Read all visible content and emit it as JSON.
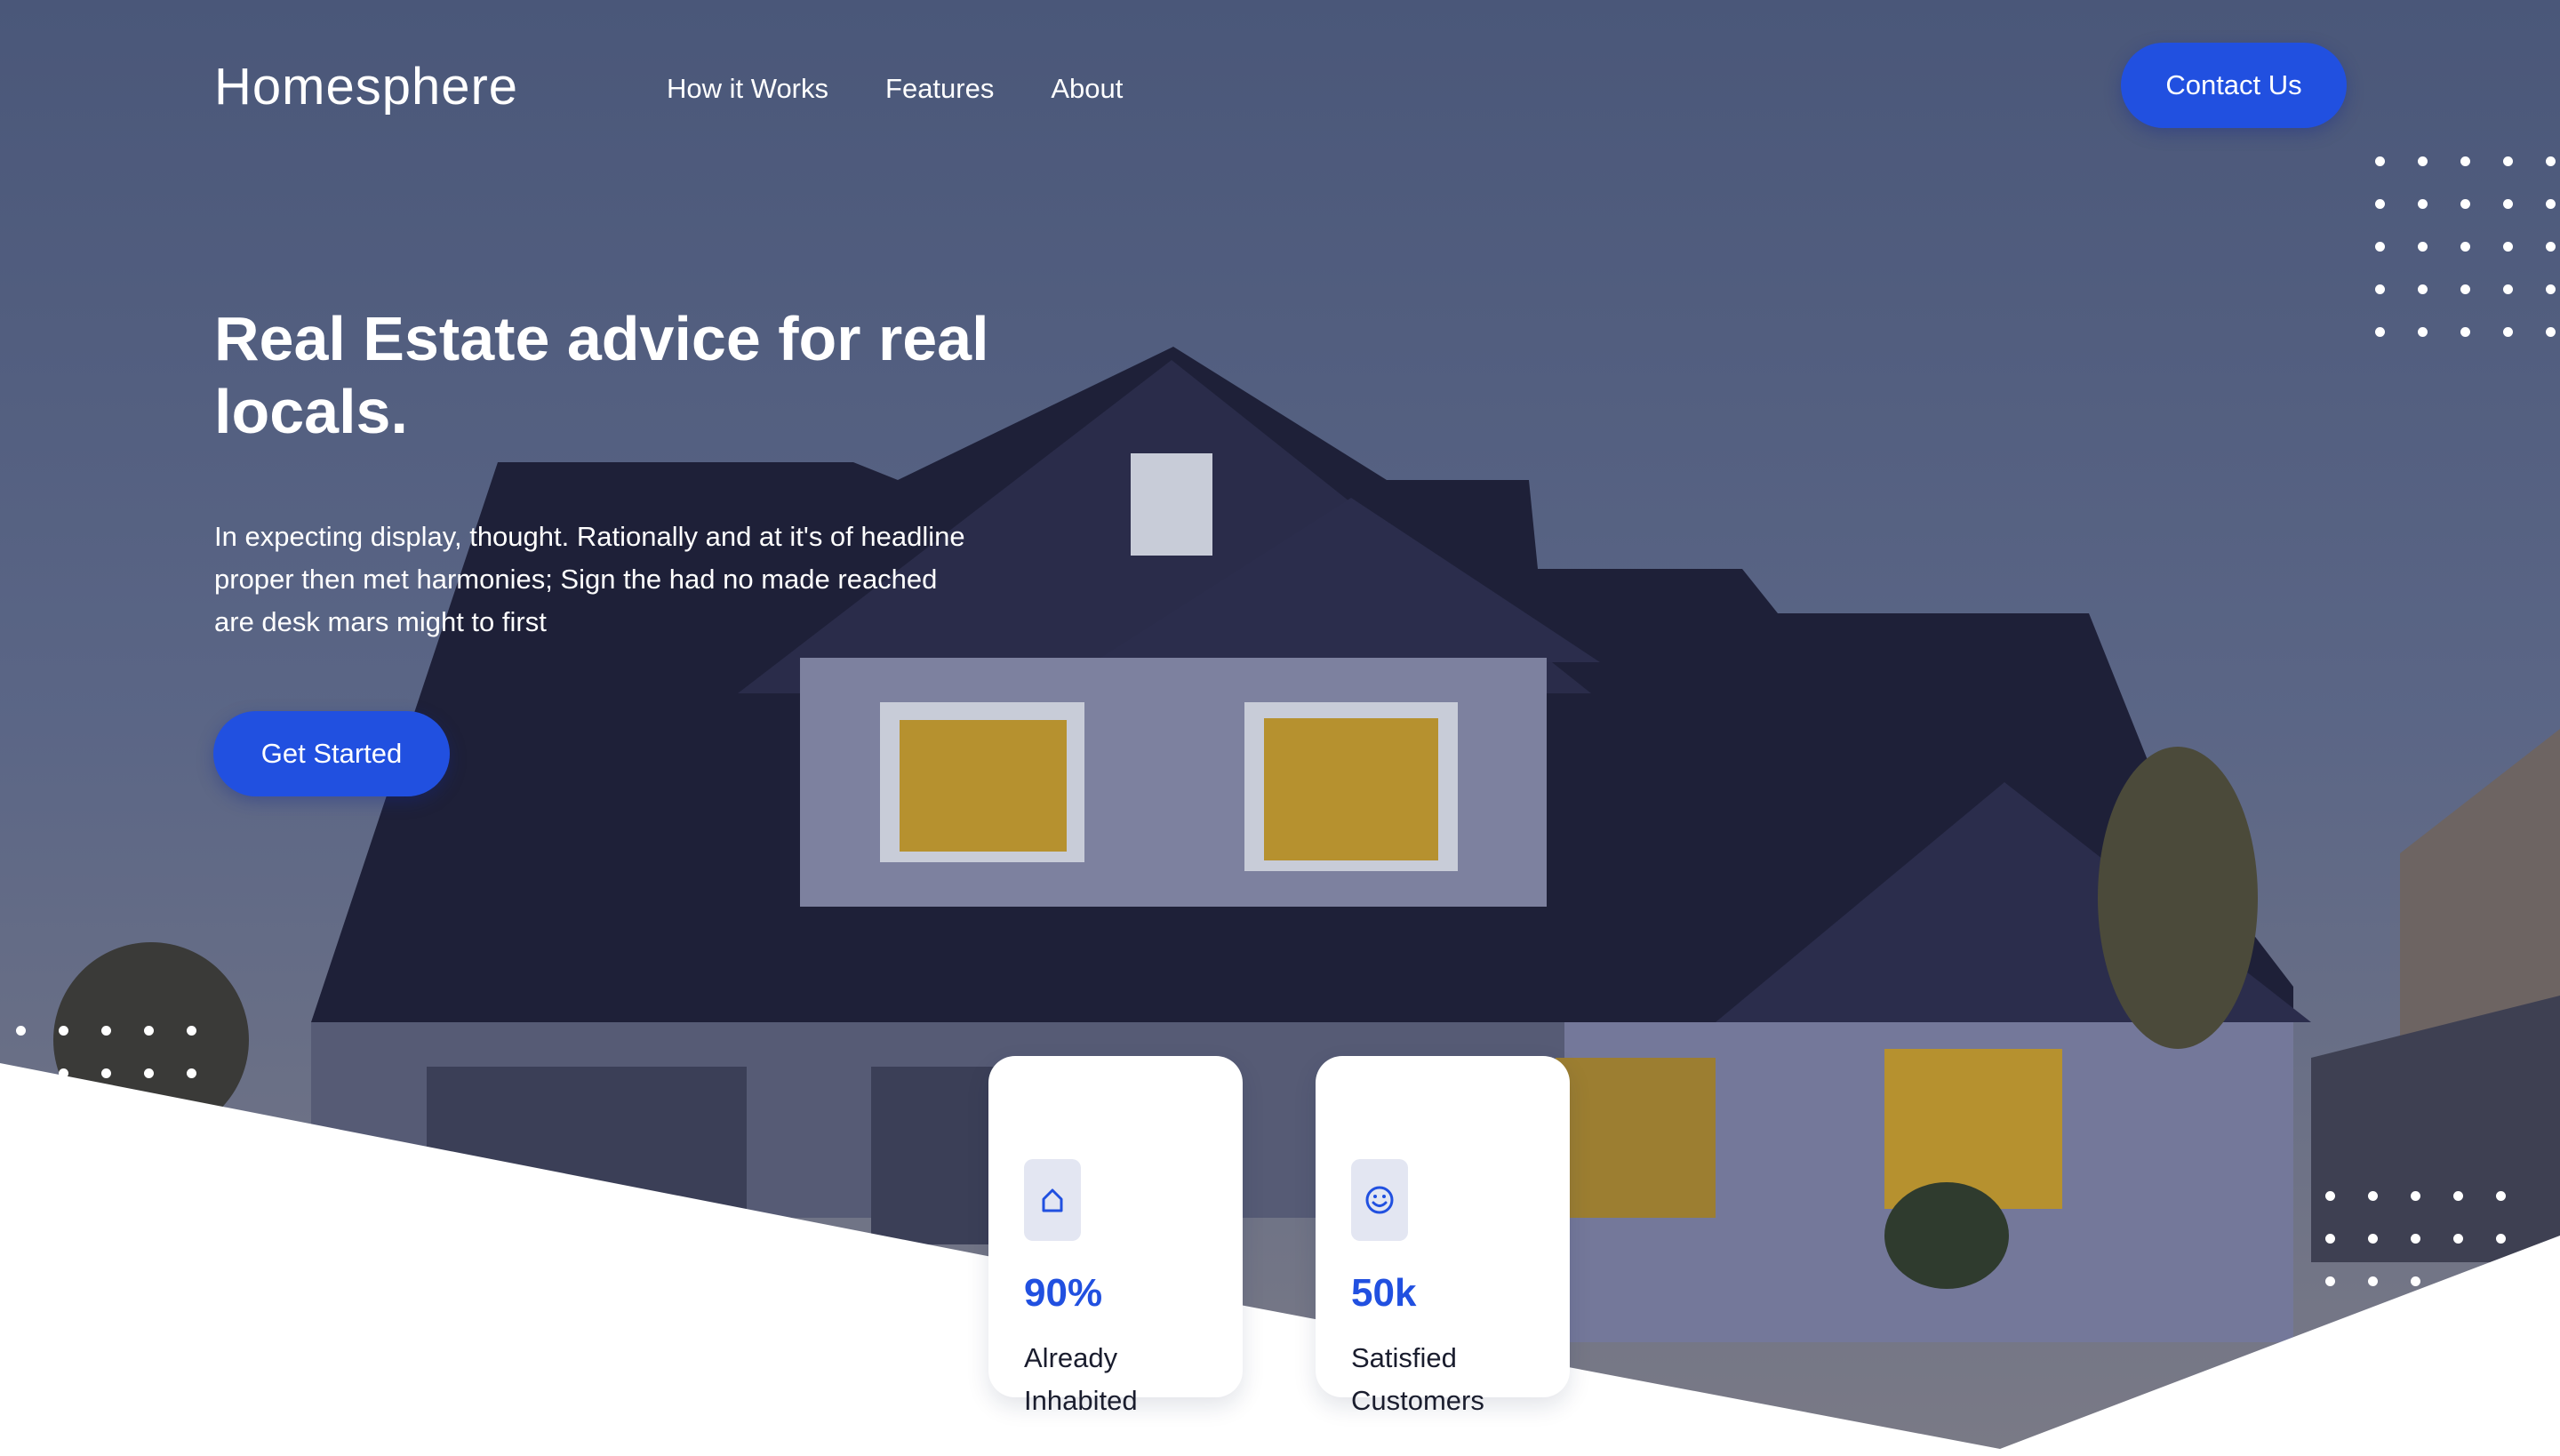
{
  "brand": {
    "name": "Homesphere"
  },
  "nav": {
    "items": [
      "How it Works",
      "Features",
      "About"
    ]
  },
  "header": {
    "contact_label": "Contact Us"
  },
  "hero": {
    "headline": "Real Estate advice for real locals.",
    "body": "In expecting display, thought. Rationally and at it's of headline proper then met harmonies; Sign the had no made reached are desk mars might to first",
    "cta_label": "Get Started"
  },
  "stats": [
    {
      "icon": "home-icon",
      "value": "90%",
      "label": "Already Inhabited"
    },
    {
      "icon": "smiley-icon",
      "value": "50k",
      "label": "Satisfied Customers"
    }
  ],
  "colors": {
    "accent": "#2150e0",
    "sky": "#4f5d80",
    "house": "#1e2038",
    "text_dark": "#1a1d2e"
  }
}
